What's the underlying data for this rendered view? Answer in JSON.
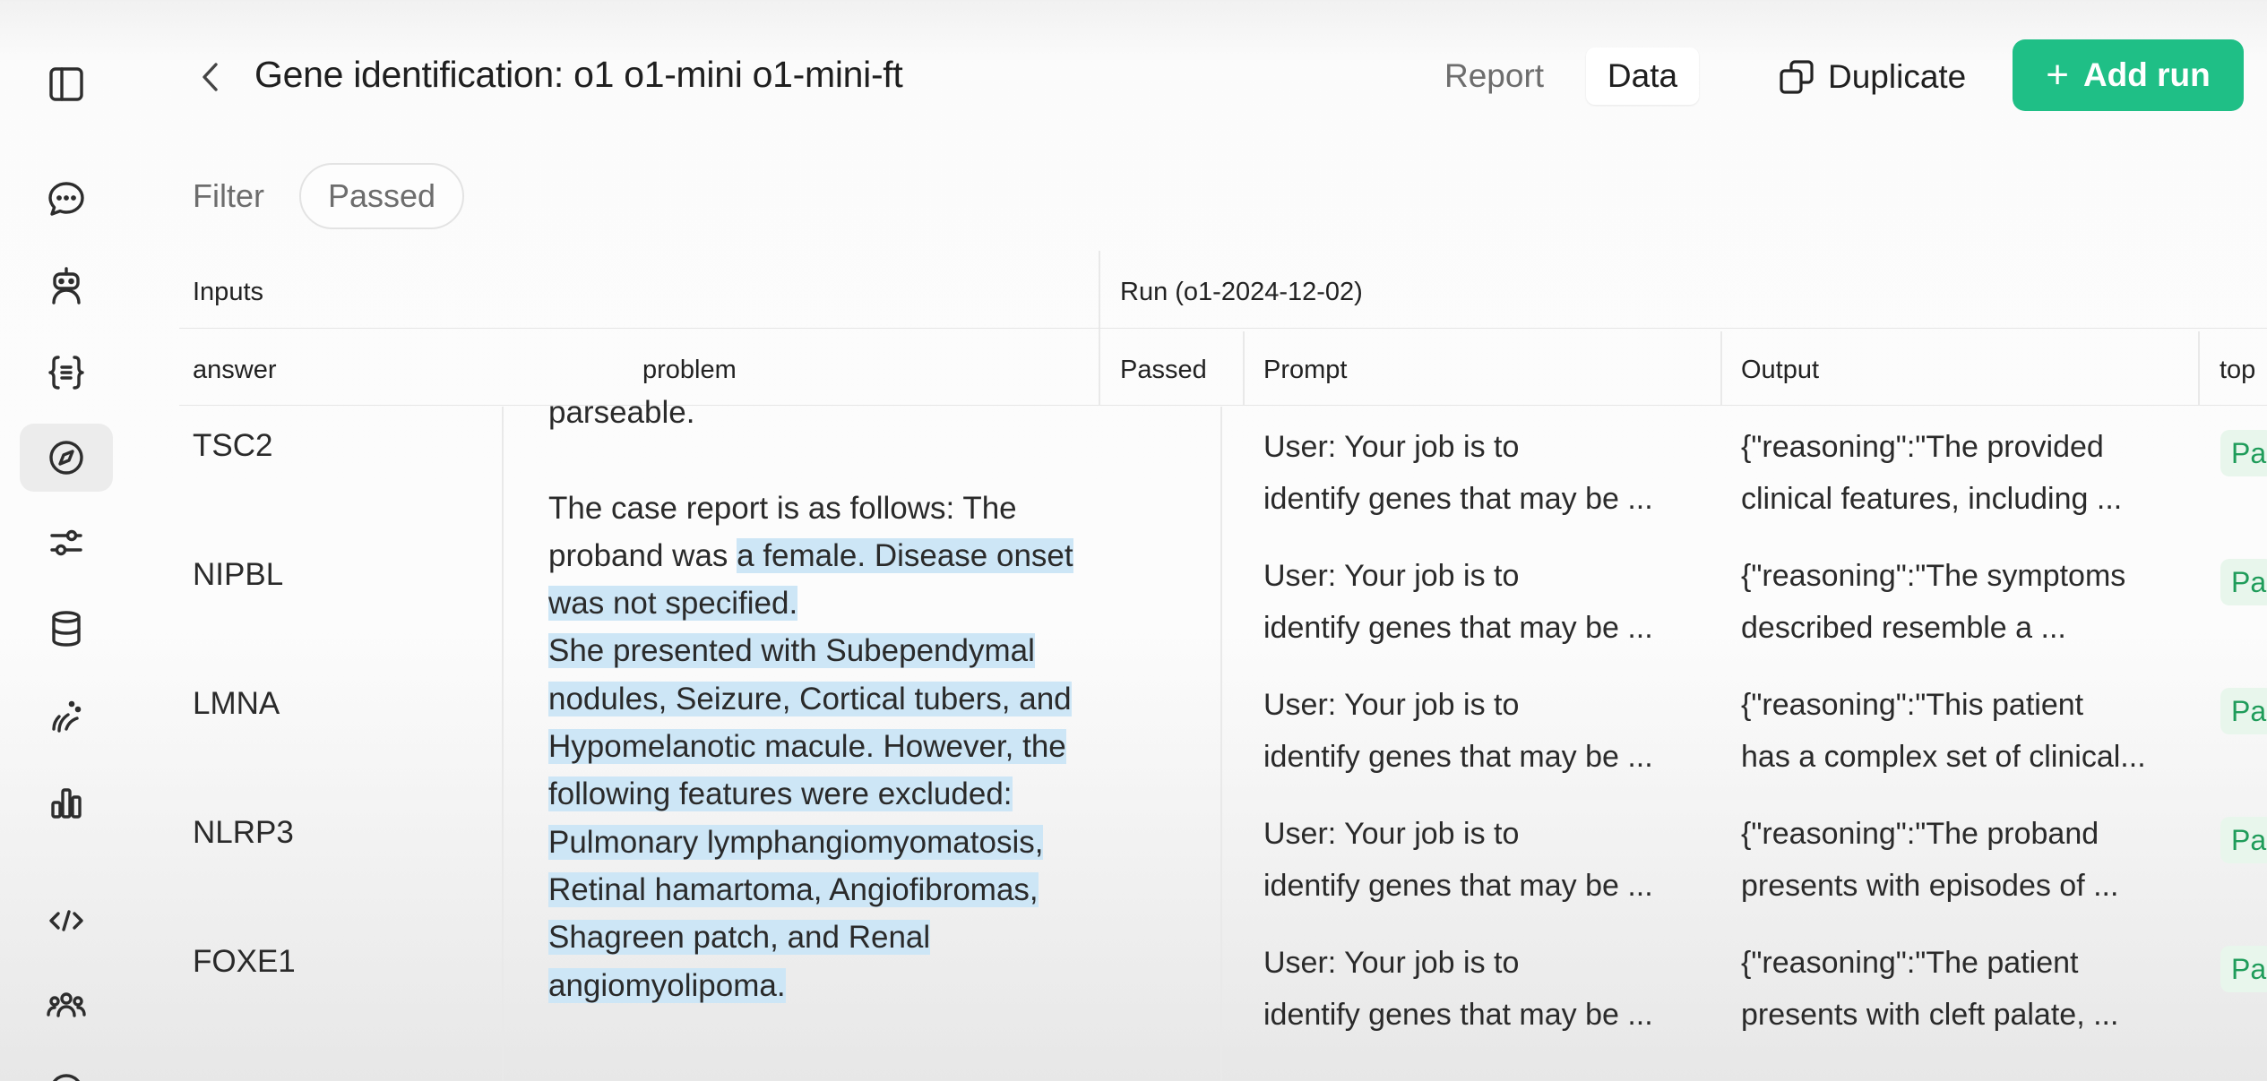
{
  "header": {
    "title": "Gene identification: o1 o1-mini o1-mini-ft",
    "tabs": [
      "Report",
      "Data"
    ],
    "active_tab": "Data",
    "duplicate_label": "Duplicate",
    "add_run_label": "Add run"
  },
  "filter": {
    "label": "Filter",
    "chip": "Passed"
  },
  "table": {
    "group_inputs": "Inputs",
    "group_run": "Run (o1-2024-12-02)",
    "columns": [
      "answer",
      "problem",
      "Passed",
      "Prompt",
      "Output",
      "top"
    ],
    "rows": [
      {
        "answer": "TSC2",
        "prompt": [
          "User: Your job is to",
          "identify genes that may be ..."
        ],
        "output": [
          "{\"reasoning\":\"The provided",
          "clinical features, including ..."
        ],
        "badge": "Pa"
      },
      {
        "answer": "NIPBL",
        "prompt": [
          "User: Your job is to",
          "identify genes that may be ..."
        ],
        "output": [
          "{\"reasoning\":\"The symptoms",
          "described resemble a ..."
        ],
        "badge": "Pa"
      },
      {
        "answer": "LMNA",
        "prompt": [
          "User: Your job is to",
          "identify genes that may be ..."
        ],
        "output": [
          "{\"reasoning\":\"This patient",
          "has a complex set of clinical..."
        ],
        "badge": "Pa"
      },
      {
        "answer": "NLRP3",
        "prompt": [
          "User: Your job is to",
          "identify genes that may be ..."
        ],
        "output": [
          "{\"reasoning\":\"The proband",
          "presents with episodes of ..."
        ],
        "badge": "Pa"
      },
      {
        "answer": "FOXE1",
        "prompt": [
          "User: Your job is to",
          "identify genes that may be ..."
        ],
        "output": [
          "{\"reasoning\":\"The patient",
          "presents with cleft palate, ..."
        ],
        "badge": "Pa"
      }
    ],
    "problem_lines": [
      {
        "pre": "parseable.",
        "hl": ""
      },
      {
        "pre": "",
        "hl": ""
      },
      {
        "pre": " The case report is as follows:  The",
        "hl": ""
      },
      {
        "pre": "proband was ",
        "hl": "a female. Disease onset"
      },
      {
        "pre": "",
        "hl": "was not specified."
      },
      {
        "pre": "",
        "hl": "She presented with Subependymal"
      },
      {
        "pre": "",
        "hl": "nodules, Seizure, Cortical tubers, and"
      },
      {
        "pre": "",
        "hl": "Hypomelanotic macule. However, the"
      },
      {
        "pre": "",
        "hl": "following features were excluded:"
      },
      {
        "pre": "",
        "hl": "Pulmonary lymphangiomyomatosis,"
      },
      {
        "pre": "",
        "hl": "Retinal hamartoma, Angiofibromas,"
      },
      {
        "pre": "",
        "hl": "Shagreen patch, and Renal"
      },
      {
        "pre": "",
        "hl": "angiomyolipoma."
      }
    ]
  },
  "sidebar": {
    "icons": [
      "panel-toggle-icon",
      "chat-icon",
      "assistant-bot-icon",
      "json-braces-icon",
      "compass-icon",
      "sliders-icon",
      "database-icon",
      "audio-wave-icon",
      "bar-chart-icon",
      "code-icon",
      "team-icon"
    ],
    "active": "compass-icon"
  }
}
